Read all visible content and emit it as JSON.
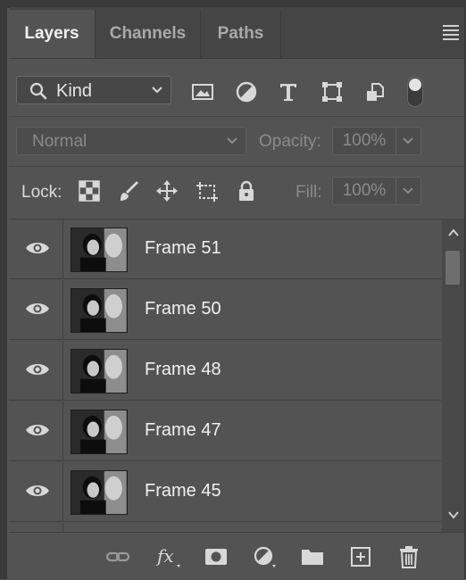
{
  "tabs": [
    {
      "label": "Layers",
      "active": true
    },
    {
      "label": "Channels",
      "active": false
    },
    {
      "label": "Paths",
      "active": false
    }
  ],
  "filter": {
    "kind_label": "Kind",
    "icons": [
      "image-filter-icon",
      "adjustment-filter-icon",
      "type-filter-icon",
      "shape-filter-icon",
      "smart-object-filter-icon"
    ],
    "toggle_on": true
  },
  "blend": {
    "mode": "Normal",
    "opacity_label": "Opacity:",
    "opacity_value": "100%"
  },
  "lock": {
    "label": "Lock:",
    "icons": [
      "lock-transparent-pixels-icon",
      "lock-image-pixels-icon",
      "lock-position-icon",
      "lock-artboard-icon",
      "lock-all-icon"
    ],
    "fill_label": "Fill:",
    "fill_value": "100%"
  },
  "layers": [
    {
      "name": "Frame 51",
      "visible": true
    },
    {
      "name": "Frame 50",
      "visible": true
    },
    {
      "name": "Frame 48",
      "visible": true
    },
    {
      "name": "Frame 47",
      "visible": true
    },
    {
      "name": "Frame 45",
      "visible": true
    }
  ],
  "bottom_icons": [
    "link-layers-icon",
    "fx-icon",
    "layer-mask-icon",
    "adjustment-layer-icon",
    "new-group-icon",
    "new-layer-icon",
    "delete-layer-icon"
  ],
  "colors": {
    "panel_bg": "#535353",
    "tab_bar_bg": "#454545",
    "text": "#f0f0f0",
    "dim_text": "#8a8a8a"
  }
}
